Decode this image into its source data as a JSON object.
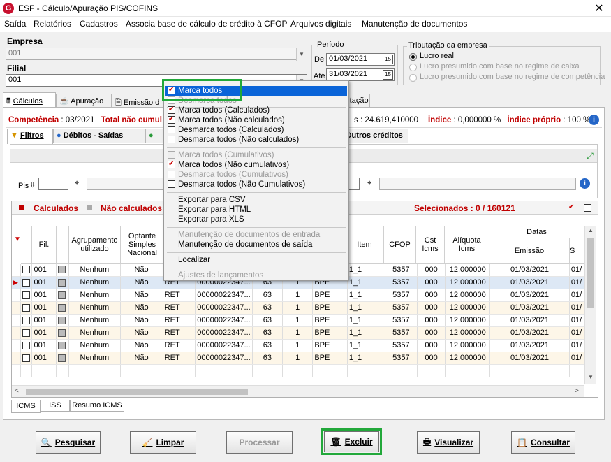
{
  "window": {
    "title": "ESF - Cálculo/Apuração PIS/COFINS",
    "close": "✕",
    "logo": "G"
  },
  "menu": [
    "Saída",
    "Relatórios",
    "Cadastros",
    "Associa base de cálculo de crédito à CFOP",
    "Arquivos digitais",
    "Manutenção de documentos"
  ],
  "empresa": {
    "label": "Empresa",
    "value": "001"
  },
  "filial": {
    "label": "Filial",
    "value": "001"
  },
  "periodo": {
    "label": "Período",
    "de_label": "De",
    "de": "01/03/2021",
    "ate_label": "Até",
    "ate": "31/03/2021",
    "cal": "15"
  },
  "tributacao": {
    "label": "Tributação da empresa",
    "options": [
      "Lucro real",
      "Lucro presumido com base no regime de caixa",
      "Lucro presumido com base no regime de competência"
    ],
    "selected": 0
  },
  "tabs": {
    "calculos": "Cálculos",
    "apuracao": "Apuração",
    "emissao": "Emissão d",
    "exportacao": "rtação"
  },
  "status": {
    "competencia_label": "Competência",
    "competencia": ": 03/2021",
    "total_label": "Total não cumul",
    "total_value": "s : 24.619,410000",
    "indice_label": "Índice",
    "indice": ": 0,000000 %",
    "indice_proprio_label": "Índice próprio",
    "indice_proprio": ": 100 %"
  },
  "subtabs": {
    "filtros": "Filtros",
    "debitos": "Débitos - Saídas",
    "outros": "Outros créditos"
  },
  "filter": {
    "pis_label": "Pis"
  },
  "legend": {
    "calculados": "Calculados",
    "nao_calculados": "Não calculados",
    "selecionados": "Selecionados : 0 / 160121"
  },
  "grid": {
    "headers": {
      "fil": "Fil.",
      "agrupamento": "Agrupamento utilizado",
      "optante": "Optante Simples Nacional",
      "item": "Item",
      "cfop": "CFOP",
      "cst": "Cst Icms",
      "aliquota": "Alíquota Icms",
      "datas": "Datas",
      "emissao": "Emissão",
      "s": "S"
    },
    "rows": [
      {
        "fil": "001",
        "agrup": "Nenhum",
        "opt": "Não",
        "ret": "",
        "doc": "",
        "c1": "",
        "c2": "",
        "c3": "",
        "item": "1_1",
        "cfop": "5357",
        "cst": "000",
        "aliq": "12,000000",
        "emissao": "01/03/2021",
        "s": "01/"
      },
      {
        "fil": "001",
        "agrup": "Nenhum",
        "opt": "Não",
        "ret": "RET",
        "doc": "00000022347...",
        "c1": "63",
        "c2": "1",
        "c3": "BPE",
        "item": "1_1",
        "cfop": "5357",
        "cst": "000",
        "aliq": "12,000000",
        "emissao": "01/03/2021",
        "s": "01/"
      },
      {
        "fil": "001",
        "agrup": "Nenhum",
        "opt": "Não",
        "ret": "RET",
        "doc": "00000022347...",
        "c1": "63",
        "c2": "1",
        "c3": "BPE",
        "item": "1_1",
        "cfop": "5357",
        "cst": "000",
        "aliq": "12,000000",
        "emissao": "01/03/2021",
        "s": "01/"
      },
      {
        "fil": "001",
        "agrup": "Nenhum",
        "opt": "Não",
        "ret": "RET",
        "doc": "00000022347...",
        "c1": "63",
        "c2": "1",
        "c3": "BPE",
        "item": "1_1",
        "cfop": "5357",
        "cst": "000",
        "aliq": "12,000000",
        "emissao": "01/03/2021",
        "s": "01/"
      },
      {
        "fil": "001",
        "agrup": "Nenhum",
        "opt": "Não",
        "ret": "RET",
        "doc": "00000022347...",
        "c1": "63",
        "c2": "1",
        "c3": "BPE",
        "item": "1_1",
        "cfop": "5357",
        "cst": "000",
        "aliq": "12,000000",
        "emissao": "01/03/2021",
        "s": "01/"
      },
      {
        "fil": "001",
        "agrup": "Nenhum",
        "opt": "Não",
        "ret": "RET",
        "doc": "00000022347...",
        "c1": "63",
        "c2": "1",
        "c3": "BPE",
        "item": "1_1",
        "cfop": "5357",
        "cst": "000",
        "aliq": "12,000000",
        "emissao": "01/03/2021",
        "s": "01/"
      },
      {
        "fil": "001",
        "agrup": "Nenhum",
        "opt": "Não",
        "ret": "RET",
        "doc": "00000022347...",
        "c1": "63",
        "c2": "1",
        "c3": "BPE",
        "item": "1_1",
        "cfop": "5357",
        "cst": "000",
        "aliq": "12,000000",
        "emissao": "01/03/2021",
        "s": "01/"
      },
      {
        "fil": "001",
        "agrup": "Nenhum",
        "opt": "Não",
        "ret": "RET",
        "doc": "00000022347...",
        "c1": "63",
        "c2": "1",
        "c3": "BPE",
        "item": "1_1",
        "cfop": "5357",
        "cst": "000",
        "aliq": "12,000000",
        "emissao": "01/03/2021",
        "s": "01/"
      }
    ]
  },
  "bottom_tabs": [
    "ICMS",
    "ISS",
    "Resumo ICMS"
  ],
  "buttons": {
    "pesquisar": "Pesquisar",
    "limpar": "Limpar",
    "processar": "Processar",
    "excluir": "Excluir",
    "visualizar": "Visualizar",
    "consultar": "Consultar"
  },
  "context_menu": {
    "marca_todos": "Marca todos",
    "desmarca_todos": "Desmarca todos",
    "marca_calc": "Marca todos (Calculados)",
    "marca_nao_calc": "Marca todos (Não calculados)",
    "desmarca_calc": "Desmarca todos (Calculados)",
    "desmarca_nao_calc": "Desmarca todos (Não calculados)",
    "marca_cumul": "Marca todos (Cumulativos)",
    "marca_nao_cumul": "Marca todos (Não cumulativos)",
    "desmarca_cumul": "Desmarca todos (Cumulativos)",
    "desmarca_nao_cumul": "Desmarca todos (Não Cumulativos)",
    "csv": "Exportar para CSV",
    "html": "Exportar para HTML",
    "xls": "Exportar para XLS",
    "manut_entrada": "Manutenção de documentos de entrada",
    "manut_saida": "Manutenção de documentos de saída",
    "localizar": "Localizar",
    "ajustes": "Ajustes de lançamentos"
  },
  "colors": {
    "highlight": "#22a83a",
    "selection": "#0a64d8",
    "red": "#c00000"
  }
}
